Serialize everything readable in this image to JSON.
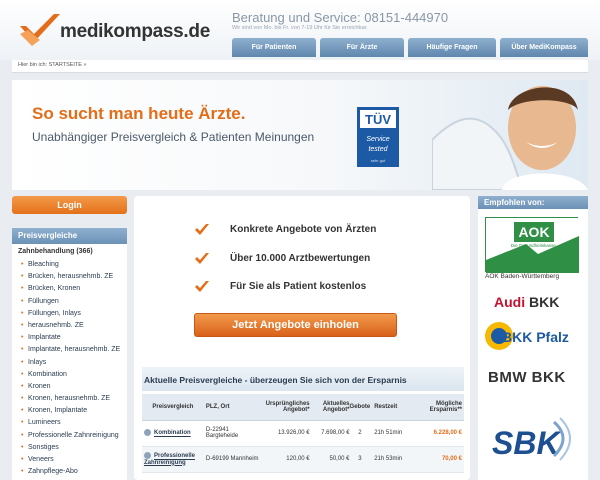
{
  "header": {
    "logo_text": "medikompass.de",
    "service_line": "Beratung und Service: 08151-444970",
    "service_sub": "Wir sind von Mo. bis Fr. von 7-19 Uhr für Sie erreichbar.",
    "nav": [
      "Für Patienten",
      "Für Ärzte",
      "Häufige Fragen",
      "Über MediKompass"
    ]
  },
  "breadcrumb": "Hier bin ich: STARTSEITE »",
  "banner": {
    "title": "So sucht man heute Ärzte.",
    "subtitle": "Unabhängiger Preisvergleich & Patienten Meinungen",
    "badge_top": "TÜV",
    "badge_main": "Service tested",
    "badge_small": "sehr gut"
  },
  "login": {
    "label": "Login"
  },
  "sidebar": {
    "heading": "Preisvergleiche",
    "category": "Zahnbehandlung (366)",
    "items": [
      "Bleaching",
      "Brücken, herausnehmb. ZE",
      "Brücken, Kronen",
      "Füllungen",
      "Füllungen, Inlays",
      "herausnehmb. ZE",
      "Implantate",
      "Implantate, herausnehmb. ZE",
      "Inlays",
      "Kombination",
      "Kronen",
      "Kronen, herausnehmb. ZE",
      "Kronen, Implantate",
      "Lumineers",
      "Professionelle Zahnreinigung",
      "Sonstiges",
      "Veneers",
      "Zahnpflege-Abo"
    ]
  },
  "features": [
    "Konkrete Angebote von Ärzten",
    "Über 10.000 Arztbewertungen",
    "Für Sie als Patient kostenlos"
  ],
  "cta": {
    "label": "Jetzt Angebote einholen"
  },
  "comparison": {
    "title": "Aktuelle Preisvergleiche - überzeugen Sie sich von der Ersparnis",
    "headers": [
      "Preisvergleich",
      "PLZ, Ort",
      "Ursprüngliches Angebot*",
      "Aktuelles Angebot*",
      "Gebote",
      "Restzeit",
      "Mögliche Ersparnis**"
    ],
    "rows": [
      {
        "name": "Kombination",
        "place": "D-22941 Bargteheide",
        "original": "13.926,00 €",
        "current": "7.698,00 €",
        "bids": "2",
        "remaining": "21h 51min",
        "savings": "6.228,00 €"
      },
      {
        "name": "Professionelle Zahnreinigung",
        "place": "D-69199 Mannheim",
        "original": "120,00 €",
        "current": "50,00 €",
        "bids": "3",
        "remaining": "21h 53min",
        "savings": "70,00 €"
      }
    ]
  },
  "recommended": {
    "heading": "Empfohlen von:",
    "aok_logo": "AOK",
    "aok_tagline": "Die Gesundheitskasse.",
    "aok_caption": "AOK Baden-Württemberg",
    "audi": "Audi",
    "audi_bkk": "BKK",
    "bkk_pfalz": "BKK Pfalz",
    "bmw_bkk": "BMW BKK",
    "sbk": "SBK"
  },
  "colors": {
    "accent": "#e36d18",
    "nav_blue": "#6b91b6",
    "aok_green": "#2f8f45",
    "sbk_blue": "#1d4f91"
  }
}
